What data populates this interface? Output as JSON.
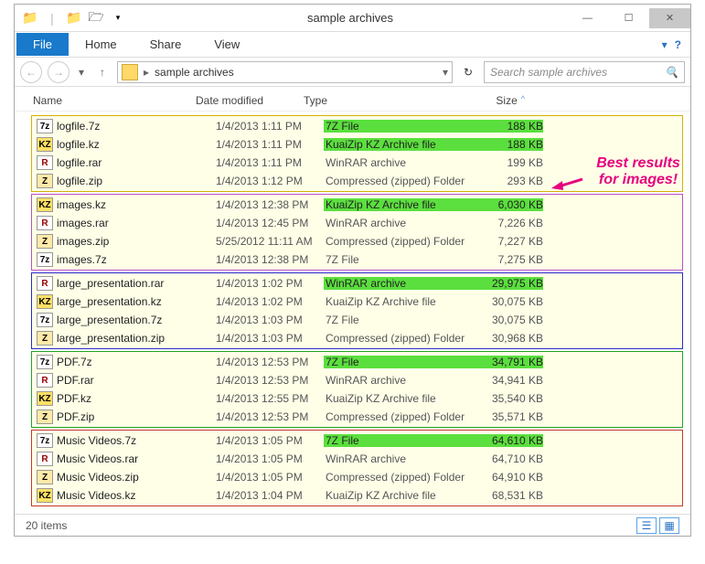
{
  "window": {
    "title": "sample archives"
  },
  "ribbon": {
    "file": "File",
    "tabs": [
      "Home",
      "Share",
      "View"
    ]
  },
  "nav": {
    "breadcrumb": "sample archives",
    "search_placeholder": "Search sample archives"
  },
  "columns": {
    "name": "Name",
    "date": "Date modified",
    "type": "Type",
    "size": "Size"
  },
  "groups": [
    {
      "border": "#d4b106",
      "rows": [
        {
          "icon": "7z",
          "name": "logfile.7z",
          "date": "1/4/2013 1:11 PM",
          "type": "7Z File",
          "size": "188 KB",
          "hlType": true,
          "hlSize": true
        },
        {
          "icon": "kz",
          "name": "logfile.kz",
          "date": "1/4/2013 1:11 PM",
          "type": "KuaiZip KZ Archive file",
          "size": "188 KB",
          "hlType": true,
          "hlSize": true
        },
        {
          "icon": "rar",
          "name": "logfile.rar",
          "date": "1/4/2013 1:11 PM",
          "type": "WinRAR archive",
          "size": "199 KB"
        },
        {
          "icon": "zip",
          "name": "logfile.zip",
          "date": "1/4/2013 1:12 PM",
          "type": "Compressed (zipped) Folder",
          "size": "293 KB"
        }
      ]
    },
    {
      "border": "#b84fc9",
      "rows": [
        {
          "icon": "kz",
          "name": "images.kz",
          "date": "1/4/2013 12:38 PM",
          "type": "KuaiZip KZ Archive file",
          "size": "6,030 KB",
          "hlType": true,
          "hlSize": true,
          "arrowTarget": true
        },
        {
          "icon": "rar",
          "name": "images.rar",
          "date": "1/4/2013 12:45 PM",
          "type": "WinRAR archive",
          "size": "7,226 KB"
        },
        {
          "icon": "zip",
          "name": "images.zip",
          "date": "5/25/2012 11:11 AM",
          "type": "Compressed (zipped) Folder",
          "size": "7,227 KB"
        },
        {
          "icon": "7z",
          "name": "images.7z",
          "date": "1/4/2013 12:38 PM",
          "type": "7Z File",
          "size": "7,275 KB"
        }
      ]
    },
    {
      "border": "#2a2ac9",
      "rows": [
        {
          "icon": "rar",
          "name": "large_presentation.rar",
          "date": "1/4/2013 1:02 PM",
          "type": "WinRAR archive",
          "size": "29,975 KB",
          "hlType": true,
          "hlSize": true
        },
        {
          "icon": "kz",
          "name": "large_presentation.kz",
          "date": "1/4/2013 1:02 PM",
          "type": "KuaiZip KZ Archive file",
          "size": "30,075 KB"
        },
        {
          "icon": "7z",
          "name": "large_presentation.7z",
          "date": "1/4/2013 1:03 PM",
          "type": "7Z File",
          "size": "30,075 KB"
        },
        {
          "icon": "zip",
          "name": "large_presentation.zip",
          "date": "1/4/2013 1:03 PM",
          "type": "Compressed (zipped) Folder",
          "size": "30,968 KB"
        }
      ]
    },
    {
      "border": "#1fa52a",
      "rows": [
        {
          "icon": "7z",
          "name": "PDF.7z",
          "date": "1/4/2013 12:53 PM",
          "type": "7Z File",
          "size": "34,791 KB",
          "hlType": true,
          "hlSize": true
        },
        {
          "icon": "rar",
          "name": "PDF.rar",
          "date": "1/4/2013 12:53 PM",
          "type": "WinRAR archive",
          "size": "34,941 KB"
        },
        {
          "icon": "kz",
          "name": "PDF.kz",
          "date": "1/4/2013 12:55 PM",
          "type": "KuaiZip KZ Archive file",
          "size": "35,540 KB"
        },
        {
          "icon": "zip",
          "name": "PDF.zip",
          "date": "1/4/2013 12:53 PM",
          "type": "Compressed (zipped) Folder",
          "size": "35,571 KB"
        }
      ]
    },
    {
      "border": "#c03a2b",
      "rows": [
        {
          "icon": "7z",
          "name": "Music Videos.7z",
          "date": "1/4/2013 1:05 PM",
          "type": "7Z File",
          "size": "64,610 KB",
          "hlType": true,
          "hlSize": true
        },
        {
          "icon": "rar",
          "name": "Music Videos.rar",
          "date": "1/4/2013 1:05 PM",
          "type": "WinRAR archive",
          "size": "64,710 KB"
        },
        {
          "icon": "zip",
          "name": "Music Videos.zip",
          "date": "1/4/2013 1:05 PM",
          "type": "Compressed (zipped) Folder",
          "size": "64,910 KB"
        },
        {
          "icon": "kz",
          "name": "Music Videos.kz",
          "date": "1/4/2013 1:04 PM",
          "type": "KuaiZip KZ Archive file",
          "size": "68,531 KB"
        }
      ]
    }
  ],
  "callout": {
    "line1": "Best results",
    "line2": "for images!"
  },
  "status": {
    "count": "20 items"
  }
}
